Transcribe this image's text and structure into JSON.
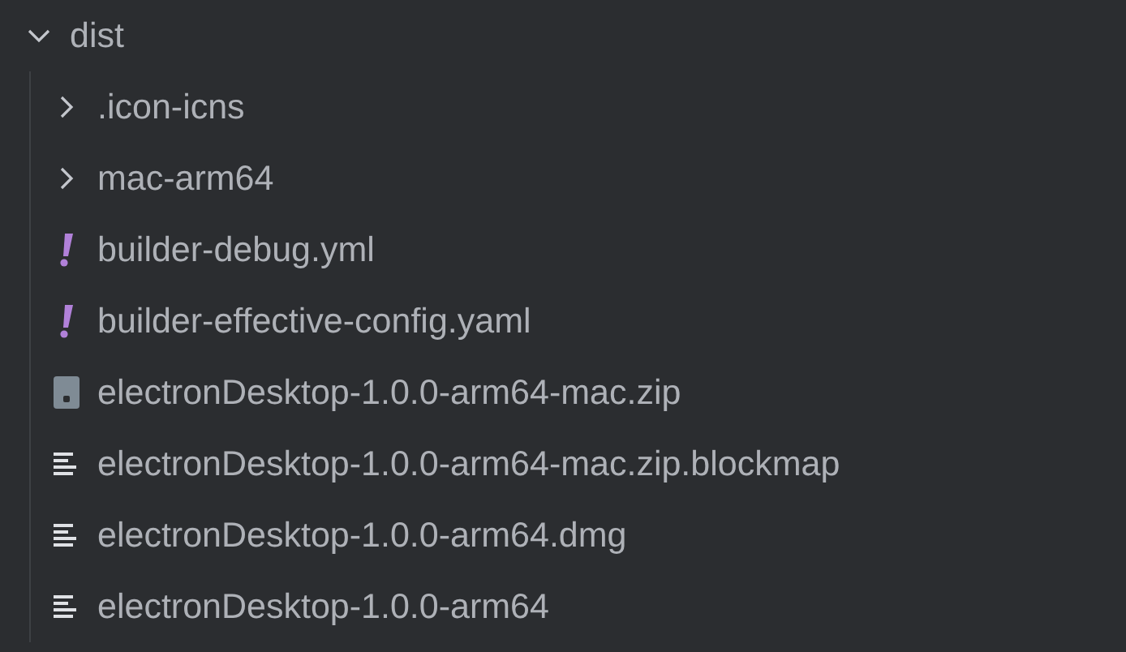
{
  "tree": {
    "label": "dist",
    "kind": "folder",
    "expanded": true,
    "children": [
      {
        "label": ".icon-icns",
        "kind": "folder",
        "expanded": false
      },
      {
        "label": "mac-arm64",
        "kind": "folder",
        "expanded": false
      },
      {
        "label": "builder-debug.yml",
        "kind": "yaml"
      },
      {
        "label": "builder-effective-config.yaml",
        "kind": "yaml"
      },
      {
        "label": "electronDesktop-1.0.0-arm64-mac.zip",
        "kind": "archive"
      },
      {
        "label": "electronDesktop-1.0.0-arm64-mac.zip.blockmap",
        "kind": "text"
      },
      {
        "label": "electronDesktop-1.0.0-arm64.dmg",
        "kind": "text"
      },
      {
        "label": "electronDesktop-1.0.0-arm64",
        "kind": "text"
      }
    ]
  }
}
